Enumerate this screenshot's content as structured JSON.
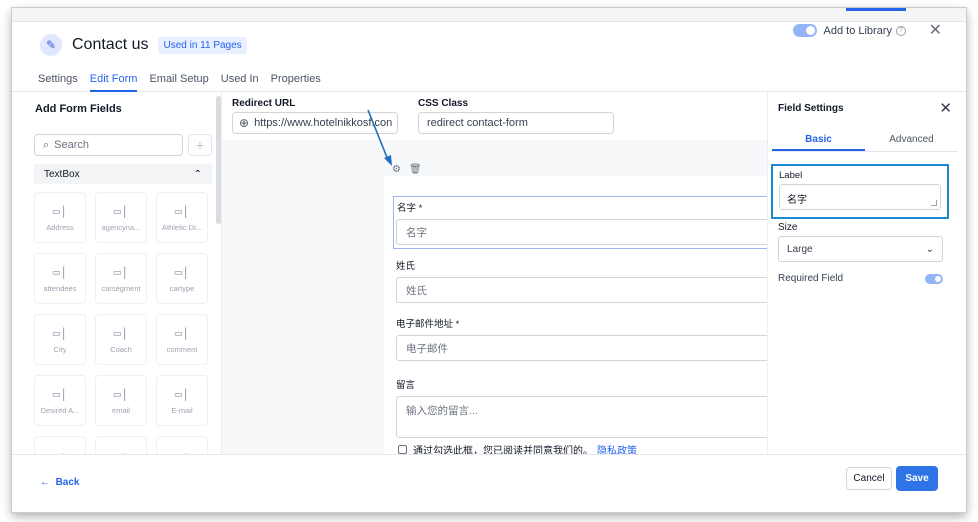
{
  "header": {
    "title": "Contact us",
    "badge": "Used in 11 Pages",
    "add_to_library": "Add to Library",
    "close": "✕"
  },
  "tabs": [
    {
      "label": "Settings",
      "active": false
    },
    {
      "label": "Edit Form",
      "active": true
    },
    {
      "label": "Email Setup",
      "active": false
    },
    {
      "label": "Used In",
      "active": false
    },
    {
      "label": "Properties",
      "active": false
    }
  ],
  "left_panel": {
    "title": "Add Form Fields",
    "search_placeholder": "Search",
    "plus": "+",
    "group_title": "TextBox",
    "fields": [
      "Address",
      "agencyna...",
      "Athletic Di...",
      "attendees",
      "carsegment",
      "cartype",
      "City",
      "Coach",
      "comment",
      "Desired A...",
      "email",
      "E-mail"
    ]
  },
  "form_settings": {
    "redirect_label": "Redirect URL",
    "redirect_value": "https://www.hotelnikkosf.con",
    "css_label": "CSS Class",
    "css_value": "redirect contact-form"
  },
  "form_fields": [
    {
      "label": "名字 *",
      "placeholder": "名字"
    },
    {
      "label": "姓氏",
      "placeholder": "姓氏"
    },
    {
      "label": "电子邮件地址 *",
      "placeholder": "电子邮件"
    },
    {
      "label": "留言",
      "placeholder": "输入您的留言..."
    }
  ],
  "agreement": {
    "text": "通过勾选此框，您已阅读并同意我们的。",
    "link": "隐私政策"
  },
  "field_settings": {
    "title": "Field Settings",
    "close": "✕",
    "tabs": [
      {
        "label": "Basic",
        "active": true
      },
      {
        "label": "Advanced",
        "active": false
      }
    ],
    "label_caption": "Label",
    "label_value": "名字",
    "size_caption": "Size",
    "size_value": "Large",
    "required_caption": "Required Field",
    "required_on": true
  },
  "footer": {
    "back": "Back",
    "cancel": "Cancel",
    "save": "Save"
  },
  "colors": {
    "accent": "#2563eb",
    "highlight": "#1a8bd1"
  }
}
